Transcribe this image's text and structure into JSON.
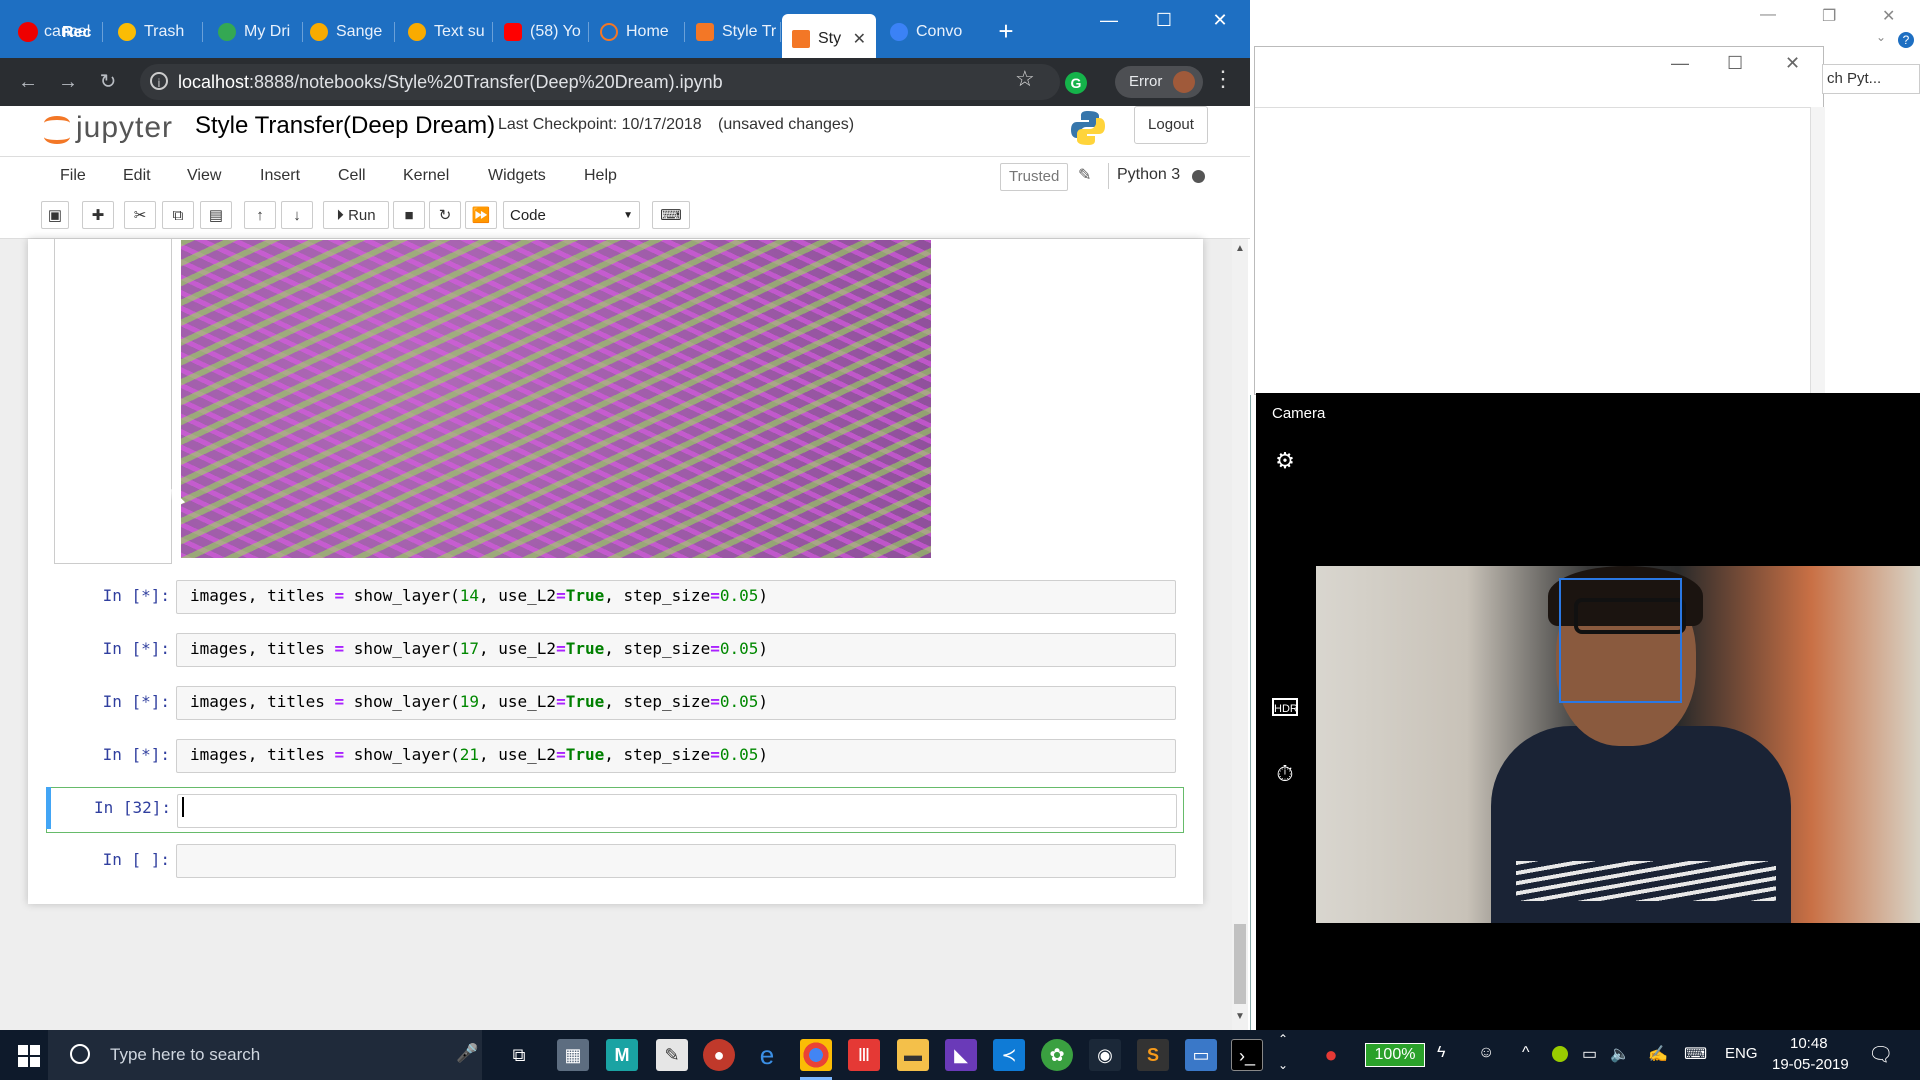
{
  "recording": {
    "label": "Rec"
  },
  "tabs": [
    {
      "label": "cancel",
      "color": "#e53935"
    },
    {
      "label": "Trash",
      "color": "#fbbc04"
    },
    {
      "label": "My Dri",
      "color": "#34a853"
    },
    {
      "label": "Sange",
      "color": "#f9ab00"
    },
    {
      "label": "Text su",
      "color": "#f9ab00"
    },
    {
      "label": "(58) Yo",
      "color": "#ff0000"
    },
    {
      "label": "Home",
      "color": "#f37726"
    },
    {
      "label": "Style Tr",
      "color": "#f37726"
    },
    {
      "label": "Sty",
      "color": "#f37726"
    },
    {
      "label": "Convo",
      "color": "#3b82f6"
    }
  ],
  "browser": {
    "url_host": "localhost",
    "url_path": ":8888/notebooks/Style%20Transfer(Deep%20Dream).ipynb",
    "error_label": "Error"
  },
  "jupyter": {
    "logo_text": "jupyter",
    "notebook_name": "Style Transfer(Deep Dream)",
    "checkpoint": "Last Checkpoint: 10/17/2018",
    "unsaved": "(unsaved changes)",
    "logout": "Logout",
    "menu": [
      "File",
      "Edit",
      "View",
      "Insert",
      "Cell",
      "Kernel",
      "Widgets",
      "Help"
    ],
    "trusted": "Trusted",
    "kernel": "Python 3",
    "run_label": "Run",
    "cell_type": "Code"
  },
  "cells": [
    {
      "prompt": "In [*]:",
      "layer": "14"
    },
    {
      "prompt": "In [*]:",
      "layer": "17"
    },
    {
      "prompt": "In [*]:",
      "layer": "19"
    },
    {
      "prompt": "In [*]:",
      "layer": "21"
    },
    {
      "prompt": "In [32]:",
      "layer": ""
    },
    {
      "prompt": "In [ ]:",
      "layer": ""
    }
  ],
  "code": {
    "prefix": "images, titles ",
    "eq": "=",
    "fn": " show_layer(",
    "arg_mid": ", use_L2",
    "eq2": "=",
    "true": "True",
    "step": ", step_size",
    "eq3": "=",
    "val": "0.05",
    "close": ")"
  },
  "side_window": {
    "search_fragment": "ch Pyt..."
  },
  "camera": {
    "title": "Camera"
  },
  "taskbar": {
    "search_placeholder": "Type here to search",
    "battery": "100%",
    "lang": "ENG",
    "time": "10:48",
    "date": "19-05-2019"
  }
}
